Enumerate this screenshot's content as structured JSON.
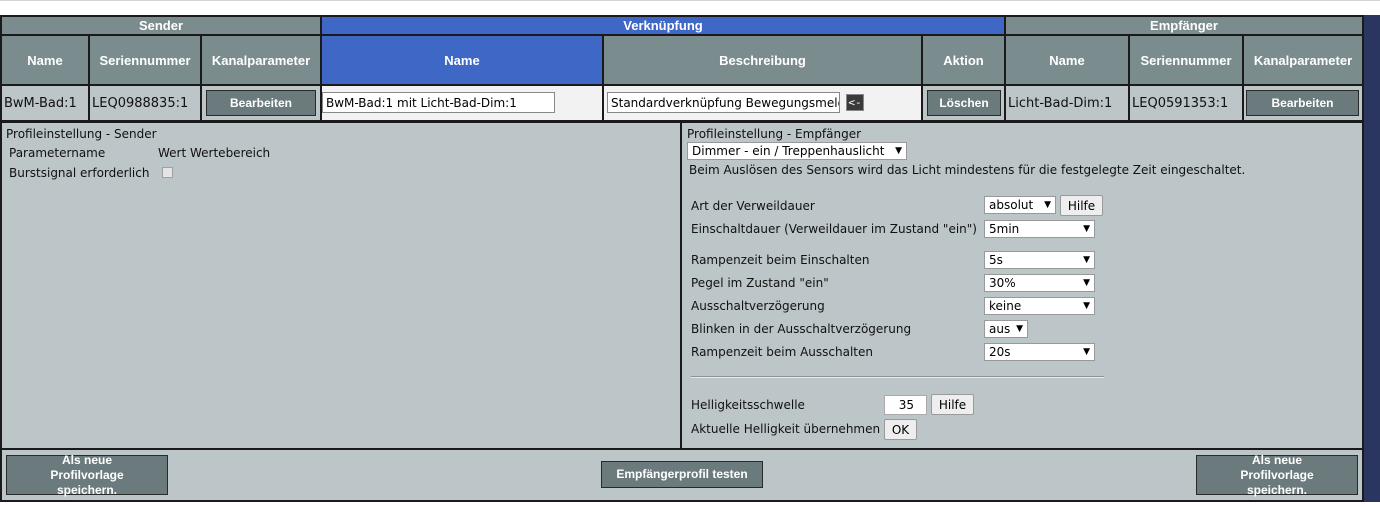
{
  "headers": {
    "sender": "Sender",
    "link": "Verknüpfung",
    "receiver": "Empfänger"
  },
  "columns": {
    "sender_name": "Name",
    "sender_serial": "Seriennummer",
    "sender_params": "Kanalparameter",
    "link_name": "Name",
    "link_description": "Beschreibung",
    "link_action": "Aktion",
    "receiver_name": "Name",
    "receiver_serial": "Seriennummer",
    "receiver_params": "Kanalparameter"
  },
  "row": {
    "sender_name": "BwM-Bad:1",
    "sender_serial": "LEQ0988835:1",
    "sender_edit_label": "Bearbeiten",
    "link_name": "BwM-Bad:1 mit Licht-Bad-Dim:1",
    "link_description": "Standardverknüpfung Bewegungsmelder",
    "link_desc_button": "<-",
    "delete_label": "Löschen",
    "receiver_name": "Licht-Bad-Dim:1",
    "receiver_serial": "LEQ0591353:1",
    "receiver_edit_label": "Bearbeiten"
  },
  "sender_profile": {
    "title": "Profileinstellung - Sender",
    "param_name_header": "Parametername",
    "value_header": "Wert",
    "range_header": "Wertebereich",
    "burst_label": "Burstsignal erforderlich",
    "burst_checked": false
  },
  "receiver_profile": {
    "title": "Profileinstellung - Empfänger",
    "profile_select": "Dimmer - ein / Treppenhauslicht",
    "description": "Beim Auslösen des Sensors wird das Licht mindestens für die festgelegte Zeit eingeschaltet.",
    "dwell_type_label": "Art der Verweildauer",
    "dwell_type_value": "absolut",
    "help_label": "Hilfe",
    "on_time_label": "Einschaltdauer (Verweildauer im Zustand \"ein\")",
    "on_time_value": "5min",
    "ramp_on_label": "Rampenzeit beim Einschalten",
    "ramp_on_value": "5s",
    "level_label": "Pegel im Zustand \"ein\"",
    "level_value": "30%",
    "off_delay_label": "Ausschaltverzögerung",
    "off_delay_value": "keine",
    "blink_label": "Blinken in der Ausschaltverzögerung",
    "blink_value": "aus",
    "ramp_off_label": "Rampenzeit beim Ausschalten",
    "ramp_off_value": "20s",
    "brightness_label": "Helligkeitsschwelle",
    "brightness_value": "35",
    "current_brightness_label": "Aktuelle Helligkeit übernehmen",
    "ok_label": "OK"
  },
  "footer": {
    "save_template_left": "Als neue Profilvorlage speichern.",
    "test_profile": "Empfängerprofil testen",
    "save_template_right": "Als neue Profilvorlage speichern."
  }
}
